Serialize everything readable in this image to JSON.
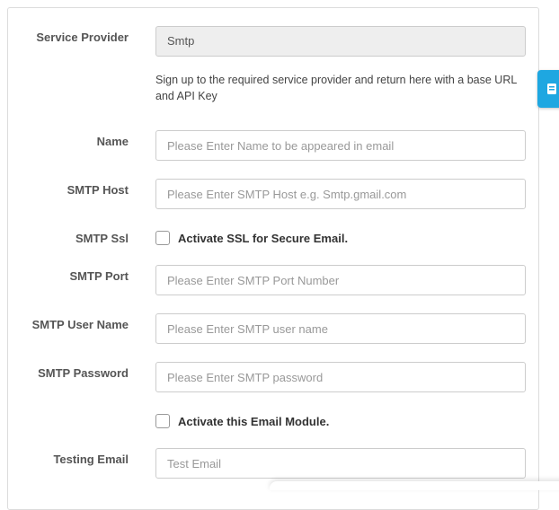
{
  "form": {
    "service_provider": {
      "label": "Service Provider",
      "value": "Smtp",
      "help": "Sign up to the required service provider and return here with a base URL and API Key"
    },
    "name": {
      "label": "Name",
      "placeholder": "Please Enter Name to be appeared in email"
    },
    "smtp_host": {
      "label": "SMTP Host",
      "placeholder": "Please Enter SMTP Host e.g. Smtp.gmail.com"
    },
    "smtp_ssl": {
      "label": "SMTP Ssl",
      "checkbox_label": "Activate SSL for Secure Email.",
      "checked": false
    },
    "smtp_port": {
      "label": "SMTP Port",
      "placeholder": "Please Enter SMTP Port Number"
    },
    "smtp_user": {
      "label": "SMTP User Name",
      "placeholder": "Please Enter SMTP user name"
    },
    "smtp_password": {
      "label": "SMTP Password",
      "placeholder": "Please Enter SMTP password"
    },
    "activate_module": {
      "checkbox_label": "Activate this Email Module.",
      "checked": false
    },
    "testing_email": {
      "label": "Testing Email",
      "placeholder": "Test Email"
    }
  },
  "side_tab": {
    "icon": "edit-icon",
    "color": "#1ea7e1"
  }
}
